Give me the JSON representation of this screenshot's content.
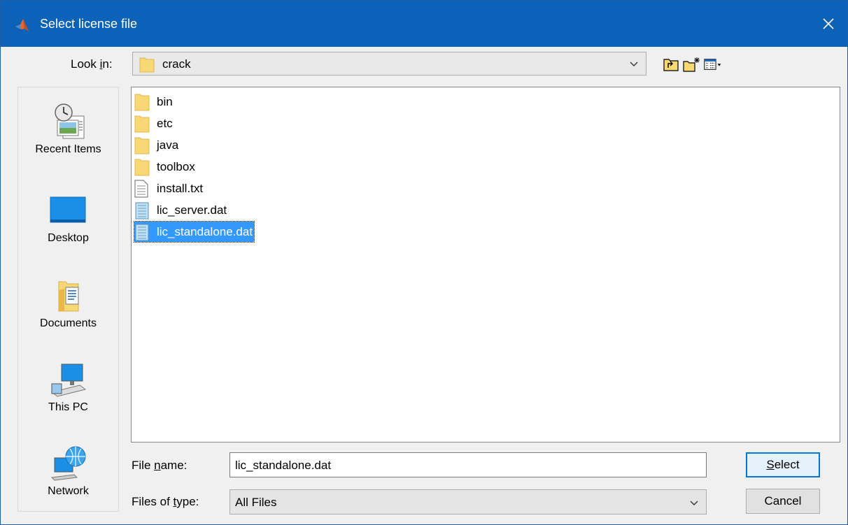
{
  "window": {
    "title": "Select license file"
  },
  "lookin": {
    "label_pre": "Look ",
    "label_ul": "i",
    "label_post": "n:",
    "value": "crack"
  },
  "toolbar": {
    "icons": [
      "up-folder-icon",
      "new-folder-icon",
      "details-view-icon"
    ]
  },
  "places": [
    {
      "label": "Recent Items",
      "icon": "recent-items-icon"
    },
    {
      "label": "Desktop",
      "icon": "desktop-icon"
    },
    {
      "label": "Documents",
      "icon": "documents-icon"
    },
    {
      "label": "This PC",
      "icon": "this-pc-icon"
    },
    {
      "label": "Network",
      "icon": "network-icon"
    }
  ],
  "files": [
    {
      "name": "bin",
      "type": "folder"
    },
    {
      "name": "etc",
      "type": "folder"
    },
    {
      "name": "java",
      "type": "folder"
    },
    {
      "name": "toolbox",
      "type": "folder"
    },
    {
      "name": "install.txt",
      "type": "text-file"
    },
    {
      "name": "lic_server.dat",
      "type": "dat-file"
    },
    {
      "name": "lic_standalone.dat",
      "type": "dat-file",
      "selected": true
    }
  ],
  "filename": {
    "label_pre": "File ",
    "label_ul": "n",
    "label_post": "ame:",
    "value": "lic_standalone.dat"
  },
  "filetype": {
    "label_pre": "Files of ",
    "label_ul": "t",
    "label_post": "ype:",
    "value": "All Files"
  },
  "buttons": {
    "select_ul": "S",
    "select_rest": "elect",
    "cancel": "Cancel"
  },
  "colors": {
    "titlebar": "#0b62b8",
    "selection": "#3399ff",
    "folder": "#f8d775"
  }
}
